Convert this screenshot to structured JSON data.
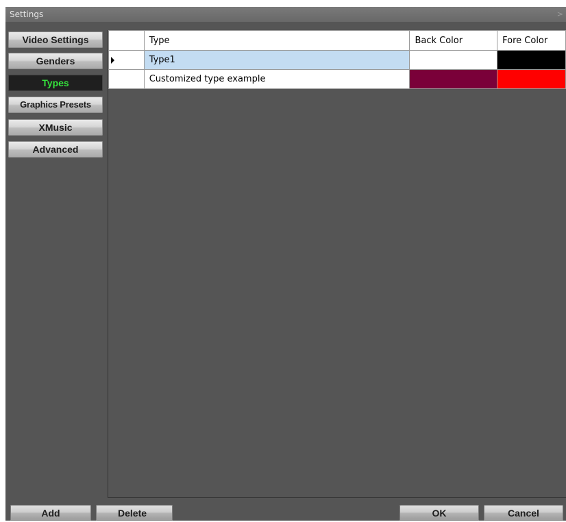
{
  "window": {
    "title": "Settings",
    "close_glyph": ">"
  },
  "sidebar": {
    "items": [
      {
        "label": "Video Settings",
        "active": false
      },
      {
        "label": "Genders",
        "active": false
      },
      {
        "label": "Types",
        "active": true
      },
      {
        "label": "Graphics Presets",
        "active": false
      },
      {
        "label": "XMusic",
        "active": false
      },
      {
        "label": "Advanced",
        "active": false
      }
    ]
  },
  "grid": {
    "columns": [
      "Type",
      "Back Color",
      "Fore Color"
    ],
    "rows": [
      {
        "type": "Type1",
        "back_color": "#ffffff",
        "fore_color": "#000000",
        "selected": true,
        "current_row_marker": "row-pointer-icon"
      },
      {
        "type": "Customized type example",
        "back_color": "#7a0039",
        "fore_color": "#ff0000",
        "selected": false
      }
    ]
  },
  "colors": {
    "active_tab_text": "#35e13c",
    "selected_row_background": "#c3dcf2",
    "panel_background": "#555555"
  },
  "buttons": {
    "add": "Add",
    "delete": "Delete",
    "ok": "OK",
    "cancel": "Cancel"
  }
}
